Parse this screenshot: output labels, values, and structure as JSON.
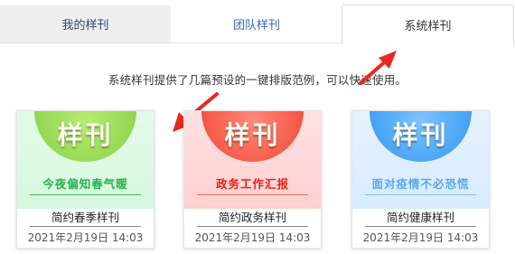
{
  "tabs": [
    {
      "label": "我的样刊",
      "active": false
    },
    {
      "label": "团队样刊",
      "active": false
    },
    {
      "label": "系统样刊",
      "active": true
    }
  ],
  "notice": "系统样刊提供了几篇预设的一键排版范例，可以快速使用。",
  "cards": [
    {
      "badge": "样刊",
      "subtitle": "今夜偏知春气暖",
      "title": "简约春季样刊",
      "date": "2021年2月19日 14:03",
      "accent": "#29b24a"
    },
    {
      "badge": "样刊",
      "subtitle": "政务工作汇报",
      "title": "简约政务样刊",
      "date": "2021年2月19日 14:03",
      "accent": "#e2231a"
    },
    {
      "badge": "样刊",
      "subtitle": "面对疫情不必恐慌",
      "title": "简约健康样刊",
      "date": "2021年2月19日 14:03",
      "accent": "#5aa8ee"
    }
  ],
  "arrows": {
    "color": "#e8281e"
  }
}
